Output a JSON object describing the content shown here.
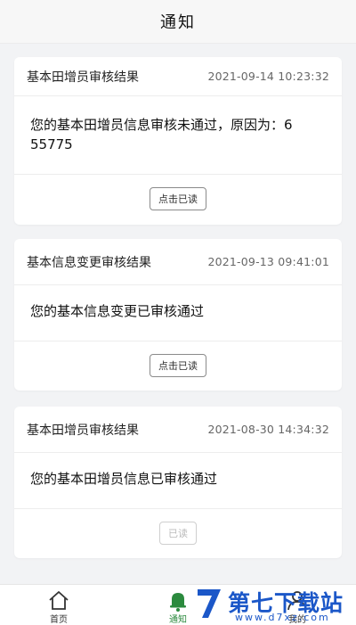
{
  "header": {
    "title": "通知"
  },
  "notifications": [
    {
      "title": "基本田增员审核结果",
      "time": "2021-09-14 10:23:32",
      "body_line1": "您的基本田增员信息审核未通过，原因为：6",
      "body_line2": "55775",
      "action": "点击已读"
    },
    {
      "title": "基本信息变更审核结果",
      "time": "2021-09-13 09:41:01",
      "body_line1": "您的基本信息变更已审核通过",
      "action": "点击已读"
    },
    {
      "title": "基本田增员审核结果",
      "time": "2021-08-30 14:34:32",
      "body_line1": "您的基本田增员信息已审核通过",
      "action": "已读"
    }
  ],
  "tabbar": {
    "items": [
      {
        "label": "首页",
        "icon": "home-icon"
      },
      {
        "label": "通知",
        "icon": "bell-icon"
      },
      {
        "label": "我的",
        "icon": "user-icon"
      }
    ],
    "active_color": "#2b8a3e"
  },
  "watermark": {
    "brand": "第七下载站",
    "domain": "www.d7xz.com"
  }
}
